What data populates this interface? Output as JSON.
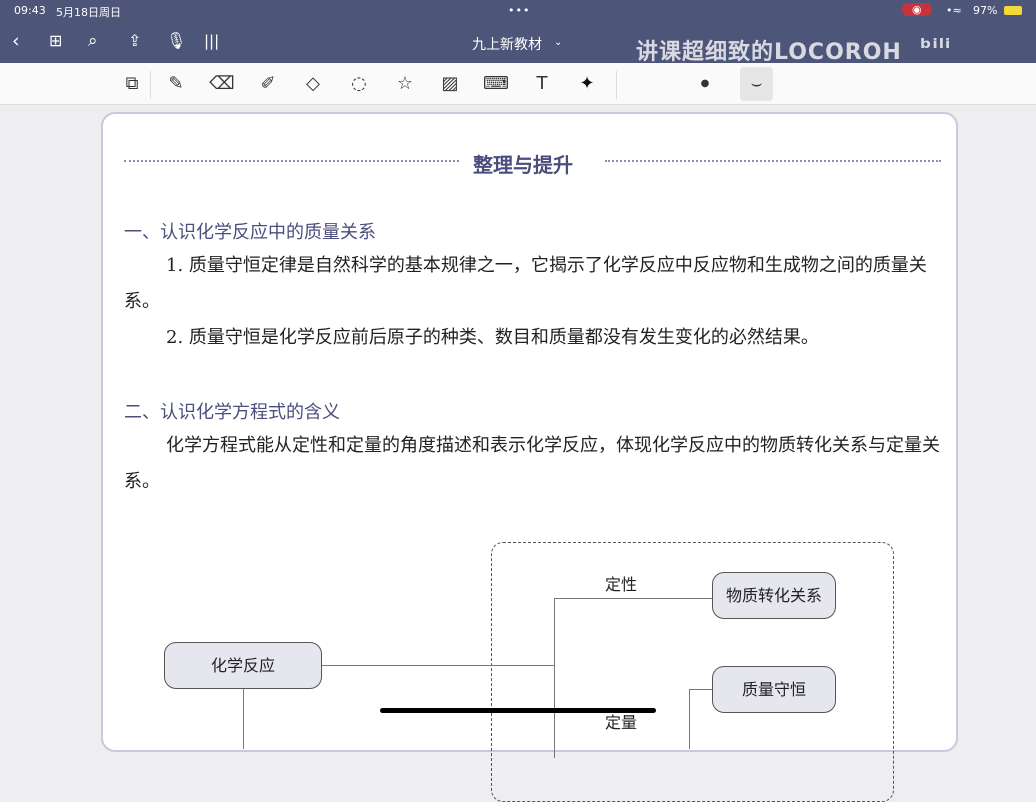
{
  "status": {
    "time": "09:43",
    "date": "5月18日周日",
    "battery": "97%"
  },
  "nav": {
    "title": "九上新教材",
    "watermark": "讲课超细致的LOCOROH",
    "logo": "bilibili"
  },
  "toolbar": {
    "tools": [
      "lasso-zoom",
      "pen",
      "eraser",
      "highlighter",
      "shapes",
      "lasso",
      "sticker",
      "image",
      "keyboard",
      "text",
      "laser-pointer"
    ]
  },
  "page": {
    "section_title": "整理与提升",
    "h1": "一、认识化学反应中的质量关系",
    "p1": "1. 质量守恒定律是自然科学的基本规律之一，它揭示了化学反应中反应物和生成物之间的质量关系。",
    "p2": "2. 质量守恒是化学反应前后原子的种类、数目和质量都没有发生变化的必然结果。",
    "h2": "二、认识化学方程式的含义",
    "p3": "化学方程式能从定性和定量的角度描述和表示化学反应，体现化学反应中的物质转化关系与定量关系。",
    "diagram": {
      "root": "化学反应",
      "qual_label": "定性",
      "qual_box": "物质转化关系",
      "quant_label": "定量",
      "quant_box1": "质量守恒"
    }
  }
}
